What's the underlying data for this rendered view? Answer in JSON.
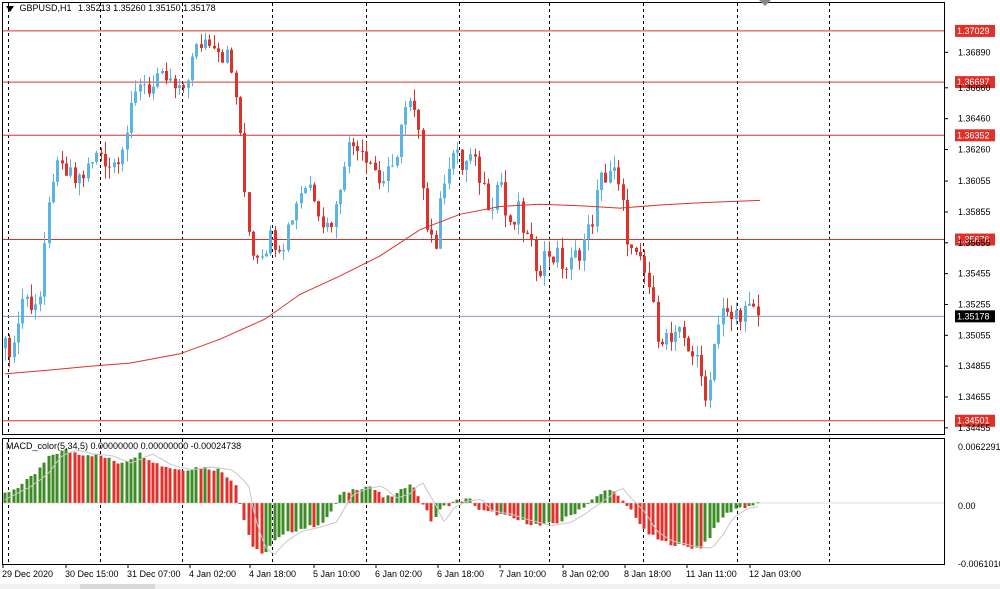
{
  "header": {
    "symbol": "GBPUSD,H1",
    "ohlc": "1.35213 1.35260 1.35150 1.35178"
  },
  "macd": {
    "label": "MACD_color(5,34,5) 0.00000000 0.00000000 -0.00024738"
  },
  "price_axis": {
    "ticks": [
      "1.36890",
      "1.36660",
      "1.36460",
      "1.36260",
      "1.36055",
      "1.35855",
      "1.35655",
      "1.35455",
      "1.35255",
      "1.35055",
      "1.34855",
      "1.34655",
      "1.34455"
    ],
    "hlines": [
      {
        "value": "1.37029",
        "price": 1.37029
      },
      {
        "value": "1.36697",
        "price": 1.36697
      },
      {
        "value": "1.36352",
        "price": 1.36352
      },
      {
        "value": "1.35676",
        "price": 1.35676
      },
      {
        "value": "1.34501",
        "price": 1.34501
      }
    ],
    "current": {
      "value": "1.35178",
      "price": 1.35178
    }
  },
  "macd_axis": {
    "ticks": [
      "0.0062291",
      "0.00",
      "-0.0061010"
    ]
  },
  "time_axis": {
    "labels": [
      "29 Dec 2020",
      "30 Dec 15:00",
      "31 Dec 07:00",
      "4 Jan 02:00",
      "4 Jan 18:00",
      "5 Jan 10:00",
      "6 Jan 02:00",
      "6 Jan 18:00",
      "7 Jan 10:00",
      "8 Jan 02:00",
      "8 Jan 18:00",
      "11 Jan 11:00",
      "12 Jan 03:00"
    ]
  },
  "colors": {
    "bull": "#5ab4e6",
    "bear": "#e0302a",
    "ma": "#e0302a",
    "hline": "#e0302a",
    "current_line": "#8a9bb8",
    "macd_up": "#3c8c24",
    "macd_down": "#e0302a",
    "signal": "#c8c8c8",
    "grid": "#000000"
  }
}
